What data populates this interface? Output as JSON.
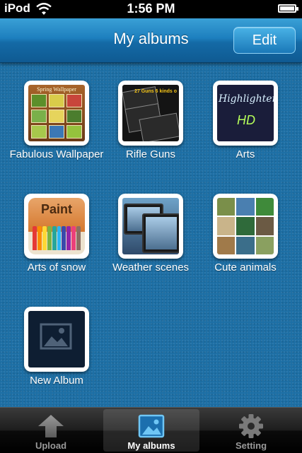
{
  "status_bar": {
    "carrier": "iPod",
    "time": "1:56 PM",
    "wifi_icon": "wifi-icon",
    "battery_icon": "battery-icon"
  },
  "nav_bar": {
    "title": "My albums",
    "edit_label": "Edit"
  },
  "albums": [
    {
      "label": "Fabulous Wallpaper",
      "thumb_text": "Spring Wallpaper"
    },
    {
      "label": "Rifle Guns",
      "thumb_text": "27 Guns 6 kinds o"
    },
    {
      "label": "Arts",
      "thumb_text_1": "Highlighter",
      "thumb_text_2": "HD"
    },
    {
      "label": "Arts of snow",
      "thumb_text": "Paint"
    },
    {
      "label": "Weather scenes"
    },
    {
      "label": "Cute animals"
    },
    {
      "label": "New Album",
      "icon": "image-placeholder-icon"
    }
  ],
  "tab_bar": {
    "tabs": [
      {
        "label": "Upload",
        "icon": "upload-arrow-icon",
        "active": false
      },
      {
        "label": "My albums",
        "icon": "photo-album-icon",
        "active": true
      },
      {
        "label": "Setting",
        "icon": "gear-icon",
        "active": false
      }
    ]
  },
  "colors": {
    "nav_blue": "#1d7fbe",
    "content_blue": "#1d6fa5",
    "tab_bar_black": "#0b0b0b"
  }
}
